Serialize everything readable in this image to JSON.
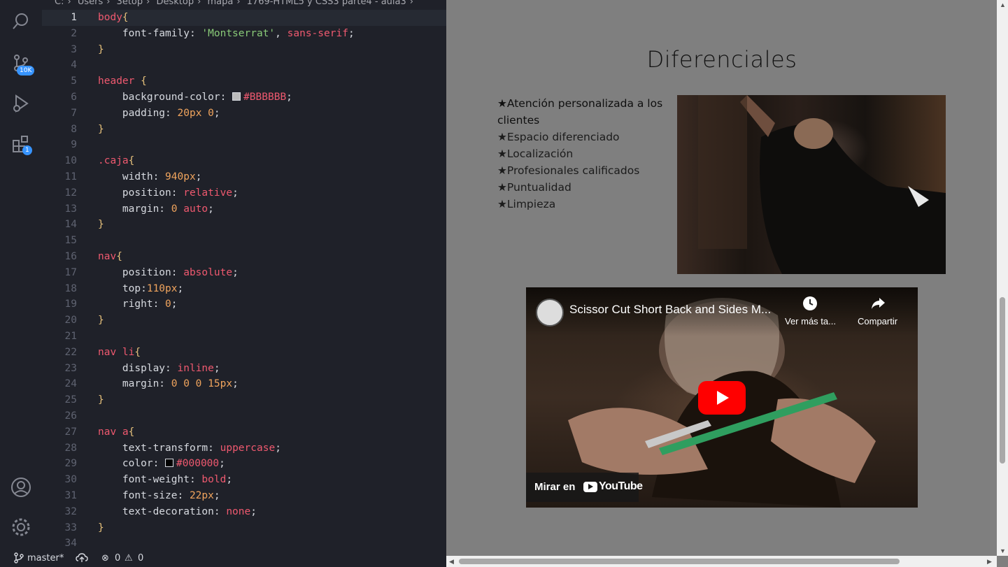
{
  "breadcrumb": [
    "C:",
    "Users",
    "3etop",
    "Desktop",
    "mapa",
    "1769-HTML5 y CSS3 parte4 - aula3"
  ],
  "activity_bar": {
    "source_control_badge": "10K",
    "extensions_badge": "1"
  },
  "code_lines": [
    {
      "n": "1",
      "parts": [
        [
          "t-sel",
          "body"
        ],
        [
          "t-brace",
          "{"
        ]
      ]
    },
    {
      "n": "2",
      "parts": [
        [
          "t-prop",
          "    font-family: "
        ],
        [
          "t-str",
          "'Montserrat'"
        ],
        [
          "t-prop",
          ", "
        ],
        [
          "t-kw",
          "sans-serif"
        ],
        [
          "t-prop",
          ";"
        ]
      ]
    },
    {
      "n": "3",
      "parts": [
        [
          "t-brace",
          "}"
        ]
      ]
    },
    {
      "n": "4",
      "parts": []
    },
    {
      "n": "5",
      "parts": [
        [
          "t-sel",
          "header "
        ],
        [
          "t-brace",
          "{"
        ]
      ]
    },
    {
      "n": "6",
      "parts": [
        [
          "t-prop",
          "    background-color: "
        ],
        [
          "swatch",
          "#BBBBBB"
        ],
        [
          "t-kw",
          "#BBBBBB"
        ],
        [
          "t-prop",
          ";"
        ]
      ]
    },
    {
      "n": "7",
      "parts": [
        [
          "t-prop",
          "    padding: "
        ],
        [
          "t-num",
          "20px 0"
        ],
        [
          "t-prop",
          ";"
        ]
      ]
    },
    {
      "n": "8",
      "parts": [
        [
          "t-brace",
          "}"
        ]
      ]
    },
    {
      "n": "9",
      "parts": []
    },
    {
      "n": "10",
      "parts": [
        [
          "t-sel",
          ".caja"
        ],
        [
          "t-brace",
          "{"
        ]
      ]
    },
    {
      "n": "11",
      "parts": [
        [
          "t-prop",
          "    width: "
        ],
        [
          "t-num",
          "940px"
        ],
        [
          "t-prop",
          ";"
        ]
      ]
    },
    {
      "n": "12",
      "parts": [
        [
          "t-prop",
          "    position: "
        ],
        [
          "t-kw",
          "relative"
        ],
        [
          "t-prop",
          ";"
        ]
      ]
    },
    {
      "n": "13",
      "parts": [
        [
          "t-prop",
          "    margin: "
        ],
        [
          "t-num",
          "0 "
        ],
        [
          "t-kw",
          "auto"
        ],
        [
          "t-prop",
          ";"
        ]
      ]
    },
    {
      "n": "14",
      "parts": [
        [
          "t-brace",
          "}"
        ]
      ]
    },
    {
      "n": "15",
      "parts": []
    },
    {
      "n": "16",
      "parts": [
        [
          "t-sel",
          "nav"
        ],
        [
          "t-brace",
          "{"
        ]
      ]
    },
    {
      "n": "17",
      "parts": [
        [
          "t-prop",
          "    position: "
        ],
        [
          "t-kw",
          "absolute"
        ],
        [
          "t-prop",
          ";"
        ]
      ]
    },
    {
      "n": "18",
      "parts": [
        [
          "t-prop",
          "    top:"
        ],
        [
          "t-num",
          "110px"
        ],
        [
          "t-prop",
          ";"
        ]
      ]
    },
    {
      "n": "19",
      "parts": [
        [
          "t-prop",
          "    right: "
        ],
        [
          "t-num",
          "0"
        ],
        [
          "t-prop",
          ";"
        ]
      ]
    },
    {
      "n": "20",
      "parts": [
        [
          "t-brace",
          "}"
        ]
      ]
    },
    {
      "n": "21",
      "parts": []
    },
    {
      "n": "22",
      "parts": [
        [
          "t-sel",
          "nav li"
        ],
        [
          "t-brace",
          "{"
        ]
      ]
    },
    {
      "n": "23",
      "parts": [
        [
          "t-prop",
          "    display: "
        ],
        [
          "t-kw",
          "inline"
        ],
        [
          "t-prop",
          ";"
        ]
      ]
    },
    {
      "n": "24",
      "parts": [
        [
          "t-prop",
          "    margin: "
        ],
        [
          "t-num",
          "0 0 0 15px"
        ],
        [
          "t-prop",
          ";"
        ]
      ]
    },
    {
      "n": "25",
      "parts": [
        [
          "t-brace",
          "}"
        ]
      ]
    },
    {
      "n": "26",
      "parts": []
    },
    {
      "n": "27",
      "parts": [
        [
          "t-sel",
          "nav a"
        ],
        [
          "t-brace",
          "{"
        ]
      ]
    },
    {
      "n": "28",
      "parts": [
        [
          "t-prop",
          "    text-transform: "
        ],
        [
          "t-kw",
          "uppercase"
        ],
        [
          "t-prop",
          ";"
        ]
      ]
    },
    {
      "n": "29",
      "parts": [
        [
          "t-prop",
          "    color: "
        ],
        [
          "swatch",
          "#000000"
        ],
        [
          "t-kw",
          "#000000"
        ],
        [
          "t-prop",
          ";"
        ]
      ]
    },
    {
      "n": "30",
      "parts": [
        [
          "t-prop",
          "    font-weight: "
        ],
        [
          "t-kw",
          "bold"
        ],
        [
          "t-prop",
          ";"
        ]
      ]
    },
    {
      "n": "31",
      "parts": [
        [
          "t-prop",
          "    font-size: "
        ],
        [
          "t-num",
          "22px"
        ],
        [
          "t-prop",
          ";"
        ]
      ]
    },
    {
      "n": "32",
      "parts": [
        [
          "t-prop",
          "    text-decoration: "
        ],
        [
          "t-kw",
          "none"
        ],
        [
          "t-prop",
          ";"
        ]
      ]
    },
    {
      "n": "33",
      "parts": [
        [
          "t-brace",
          "}"
        ]
      ]
    },
    {
      "n": "34",
      "parts": []
    }
  ],
  "current_line": "1",
  "statusbar": {
    "branch": "master*",
    "errors": "0",
    "warnings": "0"
  },
  "preview": {
    "heading": "Diferenciales",
    "items": [
      "★Atención personalizada a los clientes",
      "★Espacio diferenciado",
      "★Localización",
      "★Profesionales calificados",
      "★Puntualidad",
      "★Limpieza"
    ],
    "video": {
      "title": "Scissor Cut Short Back and Sides M...",
      "watch_later": "Ver más ta...",
      "share": "Compartir",
      "watch_on": "Mirar en",
      "youtube": "YouTube"
    }
  }
}
